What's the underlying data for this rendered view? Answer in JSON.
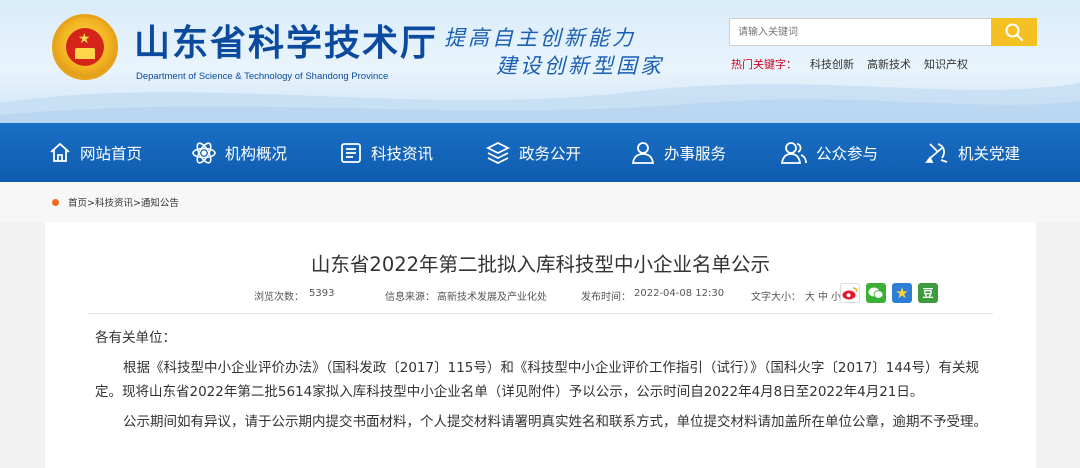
{
  "header": {
    "title": "山东省科学技术厅",
    "subtitle": "Department of Science & Technology of Shandong Province",
    "slogan_line1": "提高自主创新能力",
    "slogan_line2": "建设创新型国家"
  },
  "search": {
    "placeholder": "请输入关键词"
  },
  "hot_keywords": {
    "label": "热门关键字：",
    "items": [
      "科技创新",
      "高新技术",
      "知识产权"
    ]
  },
  "nav": {
    "items": [
      {
        "label": "网站首页",
        "icon": "home-icon"
      },
      {
        "label": "机构概况",
        "icon": "atom-icon"
      },
      {
        "label": "科技资讯",
        "icon": "news-icon"
      },
      {
        "label": "政务公开",
        "icon": "layers-icon"
      },
      {
        "label": "办事服务",
        "icon": "person-icon"
      },
      {
        "label": "公众参与",
        "icon": "people-icon"
      },
      {
        "label": "机关党建",
        "icon": "party-icon"
      }
    ]
  },
  "breadcrumb": {
    "text": "首页>科技资讯>通知公告"
  },
  "article": {
    "title": "山东省2022年第二批拟入库科技型中小企业名单公示",
    "views_label": "浏览次数：",
    "views": "5393",
    "source_label": "信息来源：",
    "source": "高新技术发展及产业化处",
    "date_label": "发布时间：",
    "date": "2022-04-08 12:30",
    "font_label": "文字大小：",
    "font_large": "大",
    "font_medium": "中",
    "font_small": "小",
    "salutation": "各有关单位：",
    "para1": "根据《科技型中小企业评价办法》（国科发政〔2017〕115号）和《科技型中小企业评价工作指引（试行）》（国科火字〔2017〕144号）有关规定。现将山东省2022年第二批5614家拟入库科技型中小企业名单（详见附件）予以公示，公示时间自2022年4月8日至2022年4月21日。",
    "para2": "公示期间如有异议，请于公示期内提交书面材料，个人提交材料请署明真实姓名和联系方式，单位提交材料请加盖所在单位公章，逾期不予受理。"
  },
  "share": {
    "icons": [
      "weibo-icon",
      "wechat-icon",
      "star-icon",
      "douban-icon"
    ],
    "douban_glyph": "豆"
  },
  "colors": {
    "brand_blue": "#0f5cb0",
    "title_blue": "#0b4a9e",
    "search_button": "#f5c022",
    "hot_label": "#d0021b",
    "crumb_dot": "#f26a1b"
  }
}
